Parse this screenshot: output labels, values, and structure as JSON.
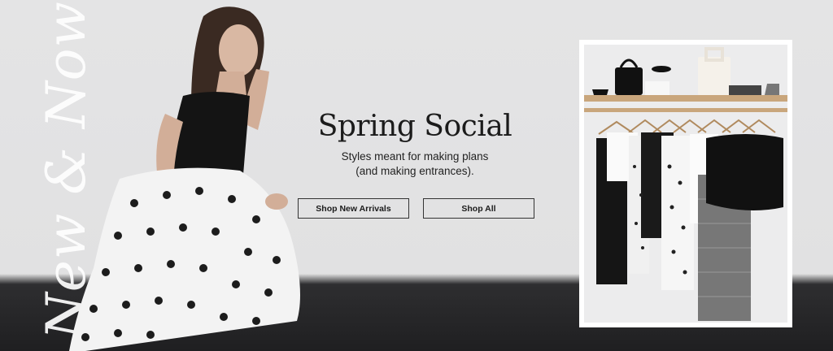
{
  "hero": {
    "script_text": "New & Now",
    "headline": "Spring Social",
    "subline_1": "Styles meant for making plans",
    "subline_2": "(and making entrances).",
    "buttons": {
      "new_arrivals": "Shop New Arrivals",
      "shop_all": "Shop All"
    }
  },
  "colors": {
    "background": "#e2e2e3",
    "floor": "#262628",
    "text": "#1b1b1b",
    "button_border": "#333333"
  },
  "images": {
    "model": "model-photo",
    "closet": "closet-rack-photo"
  }
}
